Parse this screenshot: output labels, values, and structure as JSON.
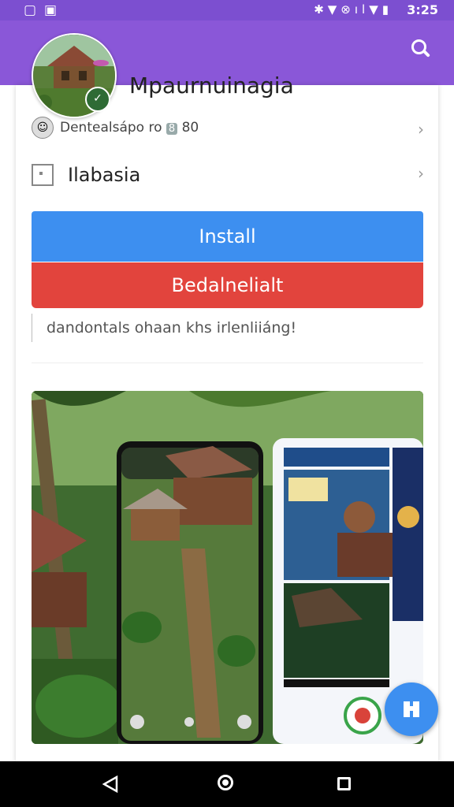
{
  "status_bar": {
    "time": "3:25",
    "left_icons": [
      "notification-icon",
      "photo-icon"
    ],
    "right_icons": [
      "bluetooth-icon",
      "wifi-icon",
      "sync-icon",
      "signal-icon",
      "battery-icon"
    ]
  },
  "app_bar": {
    "search_icon": "search-icon"
  },
  "app": {
    "name": "Mpaurnuinagia",
    "developer": "Dentealsápo ro",
    "developer_badge": "8",
    "rating": "80",
    "category": "Ilabasia"
  },
  "buttons": {
    "install": "Install",
    "secondary": "Bedalnelialt"
  },
  "description": "dandontals ohaan khs irlenliiáng!",
  "colors": {
    "status_bar": "#7c4fd0",
    "app_bar": "#8a57d8",
    "install_button": "#3d8ff0",
    "secondary_button": "#e2443d",
    "fab": "#3d8ff0",
    "nav_bar": "#000000"
  },
  "nav": {
    "back_icon": "back-icon",
    "home_icon": "home-icon",
    "recents_icon": "recents-icon"
  }
}
